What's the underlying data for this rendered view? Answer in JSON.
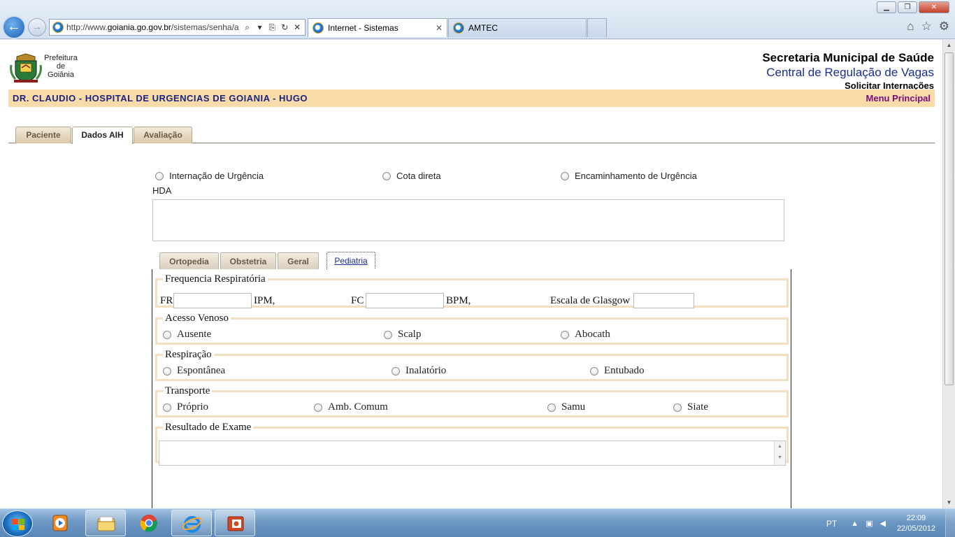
{
  "browser": {
    "address": "http://www.goiania.go.gov.br/sistemas/senha/a",
    "address_host_bold": "goiania.go.gov.br",
    "tabs": [
      {
        "label": "Internet - Sistemas",
        "close": "✕"
      },
      {
        "label": "AMTEC"
      }
    ],
    "window_buttons": {
      "minimize": "▁",
      "maximize": "❐",
      "close": "✕"
    },
    "back_glyph": "←",
    "forward_glyph": "→",
    "tools": {
      "search": "⌕",
      "dropdown": "▾",
      "compat": "⎘",
      "refresh": "↻",
      "stop": "✕"
    },
    "right_tools": {
      "home": "⌂",
      "favorites": "☆",
      "settings": "⚙"
    }
  },
  "header": {
    "logo_text": [
      "Prefeitura",
      "de",
      "Goiânia"
    ],
    "title1": "Secretaria Municipal de Saúde",
    "title2": "Central de Regulação de Vagas",
    "title3": "Solicitar Internações",
    "hospital": "DR. CLAUDIO - HOSPITAL DE URGENCIAS DE GOIANIA - HUGO",
    "menu": "Menu Principal"
  },
  "main_tabs": [
    {
      "label": "Paciente"
    },
    {
      "label": "Dados AIH"
    },
    {
      "label": "Avaliação"
    }
  ],
  "main_tabs_active": "Dados AIH",
  "admission_type": {
    "options": [
      "Internação de Urgência",
      "Cota direta",
      "Encaminhamento de Urgência"
    ]
  },
  "hda": {
    "label": "HDA",
    "value": ""
  },
  "sub_tabs": [
    {
      "label": "Ortopedia"
    },
    {
      "label": "Obstetria"
    },
    {
      "label": "Geral"
    },
    {
      "label": "Pediatria"
    }
  ],
  "sub_tabs_active": "Pediatria",
  "pediatria": {
    "freq": {
      "legend": "Frequencia Respiratória",
      "fr_label": "FR",
      "fr_unit": "IPM,",
      "fr_value": "",
      "fc_label": "FC",
      "fc_unit": "BPM,",
      "fc_value": "",
      "glasgow_label": "Escala de Glasgow",
      "glasgow_value": ""
    },
    "acesso": {
      "legend": "Acesso Venoso",
      "options": [
        "Ausente",
        "Scalp",
        "Abocath"
      ]
    },
    "respiracao": {
      "legend": "Respiração",
      "options": [
        "Espontânea",
        "Inalatório",
        "Entubado"
      ]
    },
    "transporte": {
      "legend": "Transporte",
      "options": [
        "Próprio",
        "Amb. Comum",
        "Samu",
        "Siate"
      ]
    },
    "resultado": {
      "legend": "Resultado de Exame",
      "value": ""
    }
  },
  "taskbar": {
    "language": "PT",
    "time": "22:09",
    "date": "22/05/2012",
    "pinned": [
      "media-player-icon",
      "explorer-icon",
      "chrome-icon",
      "internet-explorer-icon",
      "powerpoint-icon"
    ]
  },
  "colors": {
    "infobar_bg": "#f7dcaa",
    "hospital_text": "#1a237e",
    "menu_text": "#7b0a7b",
    "title2": "#1a2e8f",
    "fieldset_border": "#f2dfbd"
  }
}
